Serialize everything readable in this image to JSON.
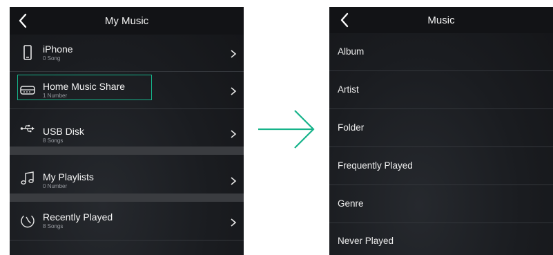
{
  "left_screen": {
    "title": "My Music",
    "items": [
      {
        "title": "iPhone",
        "subtitle": "0 Song",
        "icon": "phone-icon"
      },
      {
        "title": "Home Music Share",
        "subtitle": "1 Number",
        "icon": "nas-drive-icon",
        "highlighted": true
      },
      {
        "title": "USB Disk",
        "subtitle": "8 Songs",
        "icon": "usb-icon"
      },
      {
        "title": "My Playlists",
        "subtitle": "0 Number",
        "icon": "music-note-icon"
      },
      {
        "title": "Recently Played",
        "subtitle": "8 Songs",
        "icon": "clock-icon"
      }
    ]
  },
  "right_screen": {
    "title": "Music",
    "items": [
      "Album",
      "Artist",
      "Folder",
      "Frequently Played",
      "Genre",
      "Never Played"
    ]
  },
  "colors": {
    "highlight": "#16b38a",
    "arrow": "#16b38a",
    "panel_bg": "#1a1c20",
    "header_bg": "#121316"
  }
}
